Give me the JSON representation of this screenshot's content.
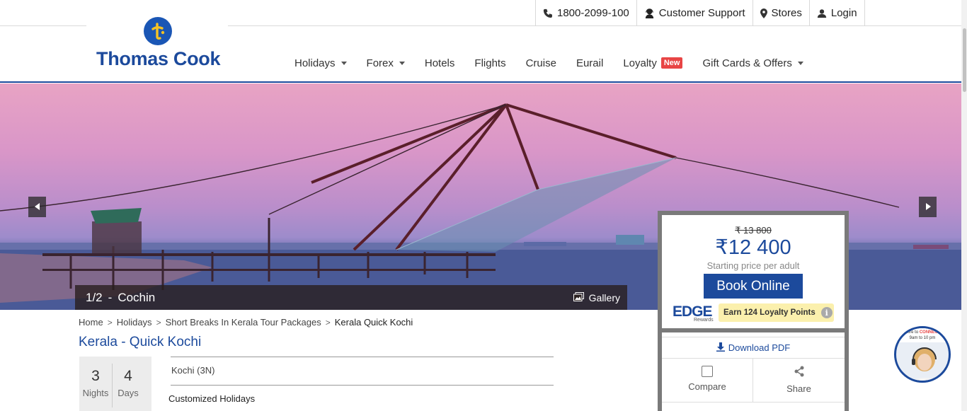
{
  "topbar": {
    "phone": "1800-2099-100",
    "support": "Customer Support",
    "stores": "Stores",
    "login": "Login"
  },
  "logo": {
    "text": "Thomas Cook"
  },
  "nav": {
    "items": [
      {
        "label": "Holidays",
        "dropdown": true
      },
      {
        "label": "Forex",
        "dropdown": true
      },
      {
        "label": "Hotels",
        "dropdown": false
      },
      {
        "label": "Flights",
        "dropdown": false
      },
      {
        "label": "Cruise",
        "dropdown": false
      },
      {
        "label": "Eurail",
        "dropdown": false
      },
      {
        "label": "Loyalty",
        "dropdown": false,
        "badge": "New"
      },
      {
        "label": "Gift Cards & Offers",
        "dropdown": true
      }
    ]
  },
  "hero": {
    "slide": "1/2",
    "separator": "-",
    "location": "Cochin",
    "gallery_label": "Gallery",
    "prev_icon": "chevron-left-icon",
    "next_icon": "chevron-right-icon"
  },
  "breadcrumb": {
    "items": [
      "Home",
      "Holidays",
      "Short Breaks In Kerala Tour Packages"
    ],
    "current": "Kerala Quick Kochi"
  },
  "tour": {
    "title": "Kerala - Quick Kochi",
    "nights": "3",
    "nights_label": "Nights",
    "days": "4",
    "days_label": "Days",
    "itinerary": "Kochi (3N)",
    "type": "Customized Holidays"
  },
  "price": {
    "old": "₹ 13 800",
    "new": "₹12 400",
    "subtitle": "Starting price per adult",
    "book_label": "Book Online",
    "edge_brand": "EDGE",
    "edge_sub": "Rewards",
    "loyalty_text": "Earn 124 Loyalty Points",
    "info_glyph": "i"
  },
  "actions": {
    "download_label": "Download PDF",
    "compare_label": "Compare",
    "share_label": "Share"
  },
  "chat": {
    "banner_prefix": "Here to",
    "banner_highlight": "CONNECT",
    "banner_hours": "9am to 10 pm"
  },
  "colors": {
    "brand": "#1c4a9c",
    "badge": "#e84545",
    "loyalty_bg": "#fbf0ad"
  }
}
